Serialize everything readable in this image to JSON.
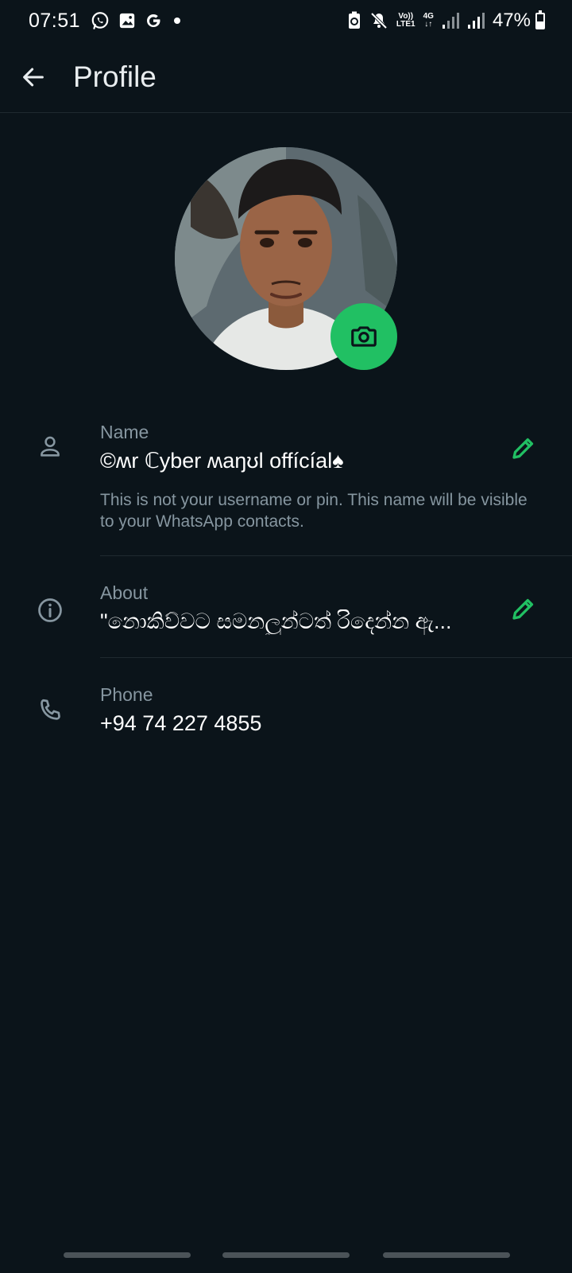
{
  "status_bar": {
    "time": "07:51",
    "network_top": "Vo))",
    "network_bottom": "LTE1",
    "network_type": "4G",
    "battery_percent": "47%",
    "battery_level": 0.47,
    "icons": [
      "whatsapp-icon",
      "gallery-icon",
      "google-icon",
      "notification-dot",
      "battery-saver-icon",
      "mute-icon",
      "signal-icon",
      "signal-icon",
      "battery-icon"
    ]
  },
  "app_bar": {
    "title": "Profile"
  },
  "profile": {
    "name_label": "Name",
    "name_value": "©ʍr ℂyber ʍaŋʊl offícíal♠",
    "name_help": "This is not your username or pin. This name will be visible to your WhatsApp contacts.",
    "about_label": "About",
    "about_value": "\"නොකිව්වට සමනලුන්ටත් රිදෙන්න ඇ...",
    "phone_label": "Phone",
    "phone_value": "+94 74 227 4855"
  },
  "colors": {
    "background": "#0b141a",
    "accent": "#21c063",
    "secondary_text": "#8696a0",
    "primary_text": "#e9edef"
  }
}
